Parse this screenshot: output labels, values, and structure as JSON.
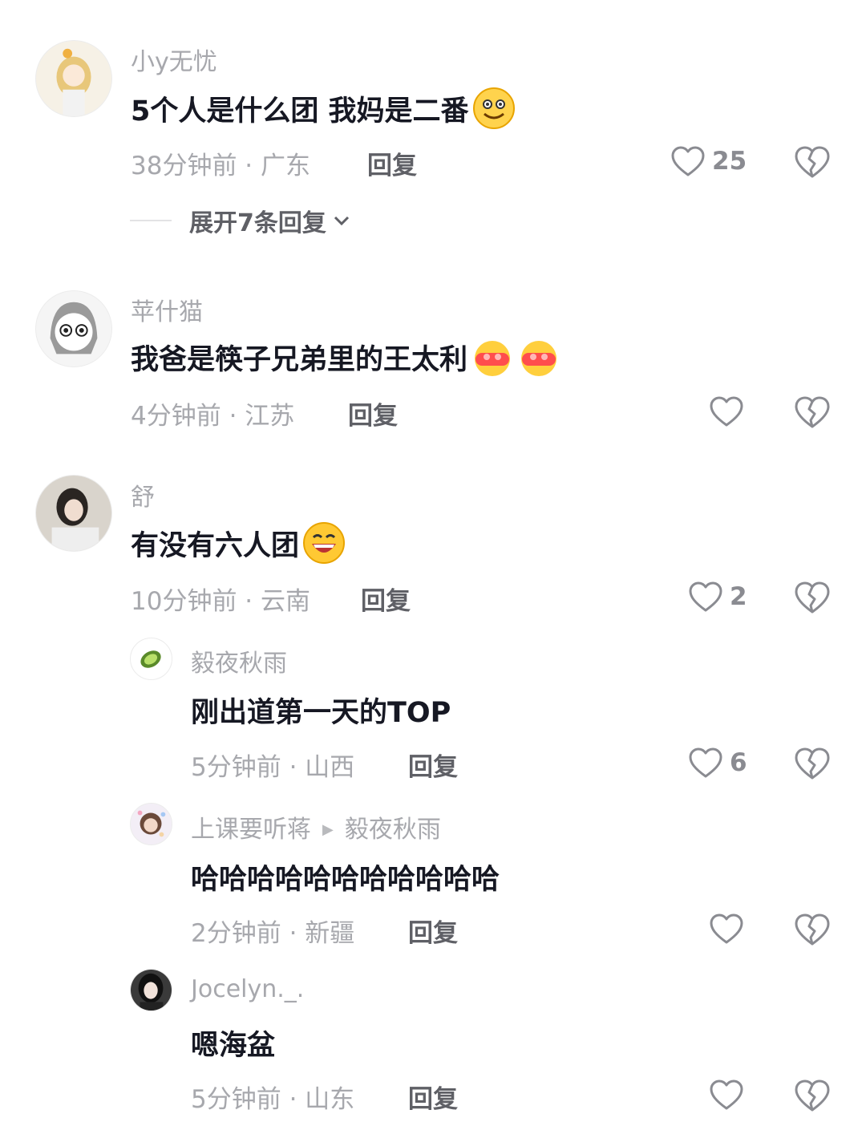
{
  "expand_label": "展开7条回复",
  "reply_label": "回复",
  "comments": [
    {
      "user": "小y无忧",
      "text": "5个人是什么团 我妈是二番",
      "time_loc": "38分钟前 · 广东",
      "likes": "25",
      "emojis": [
        "smile-emoji"
      ]
    },
    {
      "user": "苹什猫",
      "text": "我爸是筷子兄弟里的王太利",
      "time_loc": "4分钟前 · 江苏",
      "likes": "",
      "emojis": [
        "fist-emoji",
        "fist-emoji"
      ]
    },
    {
      "user": "舒",
      "text": "有没有六人团",
      "time_loc": "10分钟前 · 云南",
      "likes": "2",
      "emojis": [
        "grin-emoji"
      ]
    }
  ],
  "replies": [
    {
      "user": "毅夜秋雨",
      "reply_to": "",
      "text": "刚出道第一天的TOP",
      "time_loc": "5分钟前 · 山西",
      "likes": "6"
    },
    {
      "user": "上课要听蒋",
      "reply_to": "毅夜秋雨",
      "text": "哈哈哈哈哈哈哈哈哈哈哈",
      "time_loc": "2分钟前 · 新疆",
      "likes": ""
    },
    {
      "user": "Jocelyn._.",
      "reply_to": "",
      "text": "嗯海盆",
      "time_loc": "5分钟前 · 山东",
      "likes": ""
    }
  ],
  "colors": {
    "text": "#161823",
    "secondary": "#a7a8ad",
    "reply": "#5f6066",
    "icon": "#8a8b91"
  }
}
